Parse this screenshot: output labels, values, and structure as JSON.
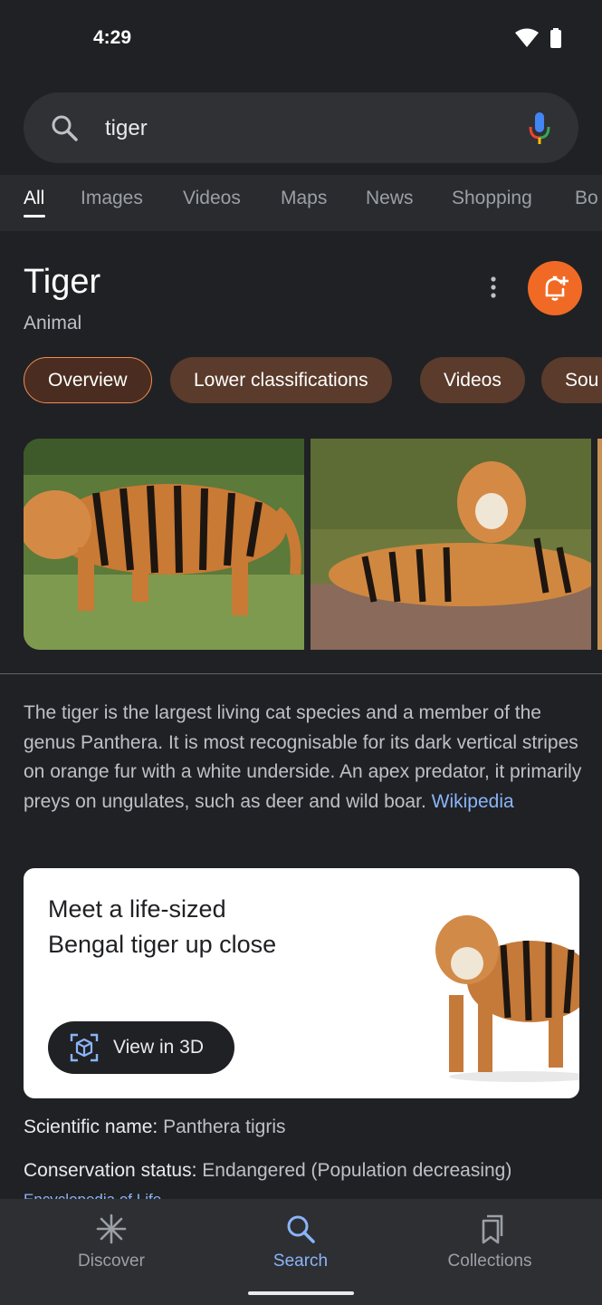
{
  "status_bar": {
    "time": "4:29"
  },
  "search": {
    "query": "tiger"
  },
  "tabs": [
    {
      "label": "All"
    },
    {
      "label": "Images"
    },
    {
      "label": "Videos"
    },
    {
      "label": "Maps"
    },
    {
      "label": "News"
    },
    {
      "label": "Shopping"
    },
    {
      "label": "Bo"
    }
  ],
  "entity": {
    "title": "Tiger",
    "subtitle": "Animal"
  },
  "chips": [
    {
      "label": "Overview"
    },
    {
      "label": "Lower classifications"
    },
    {
      "label": "Videos"
    },
    {
      "label": "Sou"
    }
  ],
  "description": {
    "text": "The tiger is the largest living cat species and a member of the genus Panthera. It is most recognisable for its dark vertical stripes on orange fur with a white underside. An apex predator, it primarily preys on ungulates, such as deer and wild boar.",
    "link": "Wikipedia"
  },
  "card_3d": {
    "text": "Meet a life-sized Bengal tiger up close",
    "button_label": "View in 3D"
  },
  "facts": [
    {
      "label": "Scientific name:",
      "value": "Panthera tigris"
    },
    {
      "label": "Conservation status:",
      "value": "Endangered (Population decreasing)"
    }
  ],
  "fact_source": "Encyclopedia of Life",
  "bottom_nav": [
    {
      "label": "Discover"
    },
    {
      "label": "Search"
    },
    {
      "label": "Collections"
    }
  ],
  "colors": {
    "background": "#202124",
    "accent_orange": "#f06a25",
    "chip_brown": "#5b3b2b",
    "link_blue": "#8ab4f8"
  }
}
